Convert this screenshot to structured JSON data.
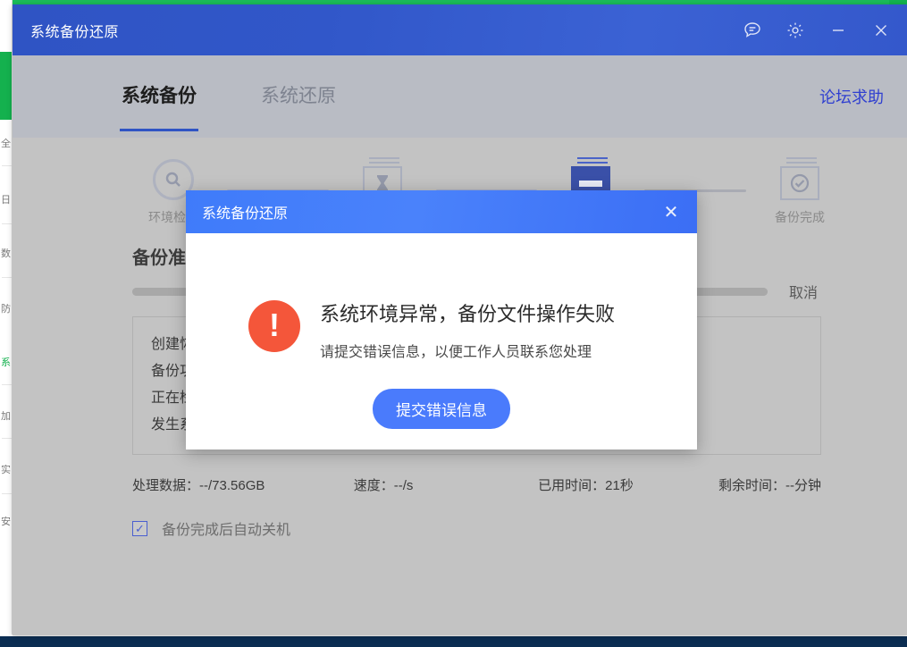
{
  "window": {
    "title": "系统备份还原",
    "controls": {
      "feedback_icon": "message-bubble-icon",
      "settings_icon": "gear-icon",
      "minimize_icon": "minimize-icon",
      "close_icon": "close-icon"
    }
  },
  "tabs": [
    {
      "label": "系统备份",
      "active": true
    },
    {
      "label": "系统还原",
      "active": false
    }
  ],
  "forum_link": "论坛求助",
  "steps": [
    {
      "label": "环境检测",
      "icon": "magnifier-circle-icon",
      "state": "done"
    },
    {
      "label": "",
      "icon": "hourglass-doc-icon",
      "state": "done"
    },
    {
      "label": "",
      "icon": "backup-doc-icon",
      "state": "active"
    },
    {
      "label": "备份完成",
      "icon": "check-doc-icon",
      "state": "pending"
    }
  ],
  "section": {
    "title": "备份准备",
    "cancel_label": "取消"
  },
  "log_lines": [
    "创建恢复",
    "备份功能",
    "正在检索",
    "发生系统"
  ],
  "stats": {
    "processed": "处理数据：--/73.56GB",
    "speed": "速度：--/s",
    "elapsed": "已用时间：21秒",
    "remaining": "剩余时间：--分钟"
  },
  "auto_shutdown": {
    "checked": true,
    "check_glyph": "✓",
    "label": "备份完成后自动关机"
  },
  "modal": {
    "title": "系统备份还原",
    "close_glyph": "✕",
    "alert_icon": "error-exclamation-icon",
    "alert_glyph": "!",
    "message_main": "系统环境异常，备份文件操作失败",
    "message_sub": "请提交错误信息，以便工作人员联系您处理",
    "submit_label": "提交错误信息"
  },
  "colors": {
    "titlebar_blue": "#3157c9",
    "modal_blue": "#4a82fb",
    "accent_link": "#2f3fd0",
    "error_red": "#f4563a",
    "window_gray": "#c3c3c3"
  }
}
